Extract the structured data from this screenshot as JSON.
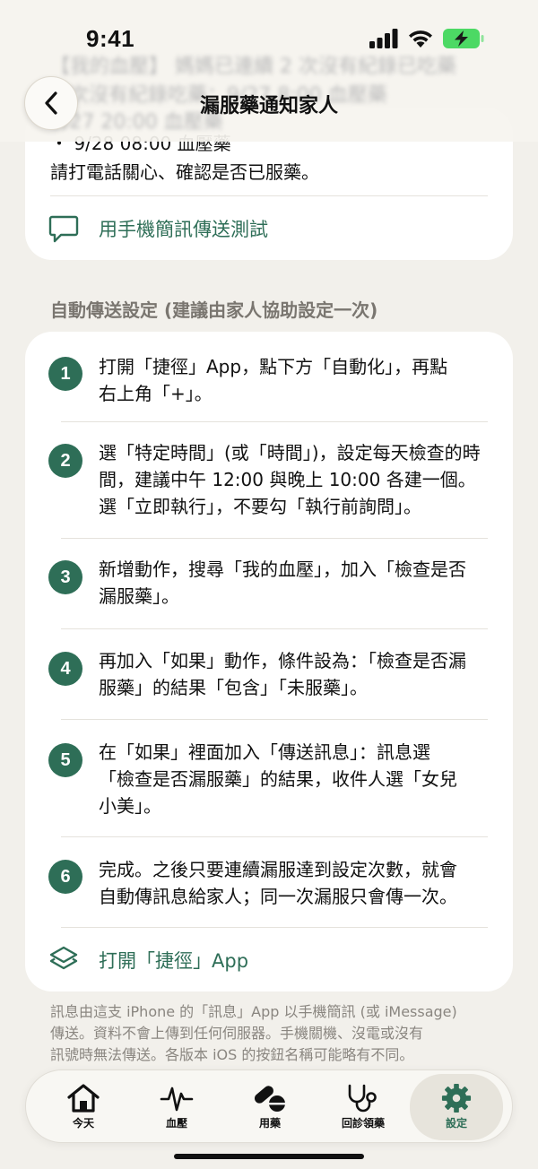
{
  "status": {
    "time": "9:41"
  },
  "background_preview": {
    "line1": "【我的血壓】 媽媽已連續 2 次沒有紀錄已吃藥",
    "line2": "3 次沒有紀錄吃藥：9/27 8:00 血壓藥",
    "line3": "9/27 20:00 血壓藥"
  },
  "nav": {
    "title": "漏服藥通知家人"
  },
  "preview_card": {
    "line1": "・ 9/28 08:00 血壓藥",
    "line2": "請打電話關心、確認是否已服藥。",
    "sms_test_label": "用手機簡訊傳送測試"
  },
  "section_header": "自動傳送設定 (建議由家人協助設定一次)",
  "steps": [
    {
      "num": "1",
      "lines": [
        "打開「捷徑」App，點下方「自動化」，再點",
        "右上角「+」。"
      ]
    },
    {
      "num": "2",
      "lines": [
        "選「特定時間」(或「時間」)，設定每天檢查的時",
        "間，建議中午 12:00 與晚上 10:00 各建一個。",
        "選「立即執行」，不要勾「執行前詢問」。"
      ]
    },
    {
      "num": "3",
      "lines": [
        "新增動作，搜尋「我的血壓」，加入「檢查是否",
        "漏服藥」。"
      ]
    },
    {
      "num": "4",
      "lines": [
        "再加入「如果」動作，條件設為：「檢查是否漏",
        "服藥」的結果「包含」「未服藥」。"
      ]
    },
    {
      "num": "5",
      "lines": [
        "在「如果」裡面加入「傳送訊息」：訊息選",
        "「檢查是否漏服藥」的結果，收件人選「女兒",
        "小美」。"
      ]
    },
    {
      "num": "6",
      "lines": [
        "完成。之後只要連續漏服達到設定次數，就會",
        "自動傳訊息給家人；同一次漏服只會傳一次。"
      ]
    }
  ],
  "open_shortcuts_label": "打開「捷徑」App",
  "footnote": {
    "line1": "訊息由這支 iPhone 的「訊息」App 以手機簡訊 (或 iMessage)",
    "line2": "傳送。資料不會上傳到任何伺服器。手機關機、沒電或沒有",
    "line3": "訊號時無法傳送。各版本 iOS 的按鈕名稱可能略有不同。"
  },
  "tabs": [
    {
      "label": "今天",
      "icon": "house-icon",
      "active": false
    },
    {
      "label": "血壓",
      "icon": "heartbeat-icon",
      "active": false
    },
    {
      "label": "用藥",
      "icon": "pills-icon",
      "active": false
    },
    {
      "label": "回診領藥",
      "icon": "stethoscope-icon",
      "active": false
    },
    {
      "label": "設定",
      "icon": "gear-icon",
      "active": true
    }
  ],
  "colors": {
    "accent": "#2e6e57",
    "background": "#f2f0eb",
    "card": "#ffffff"
  }
}
